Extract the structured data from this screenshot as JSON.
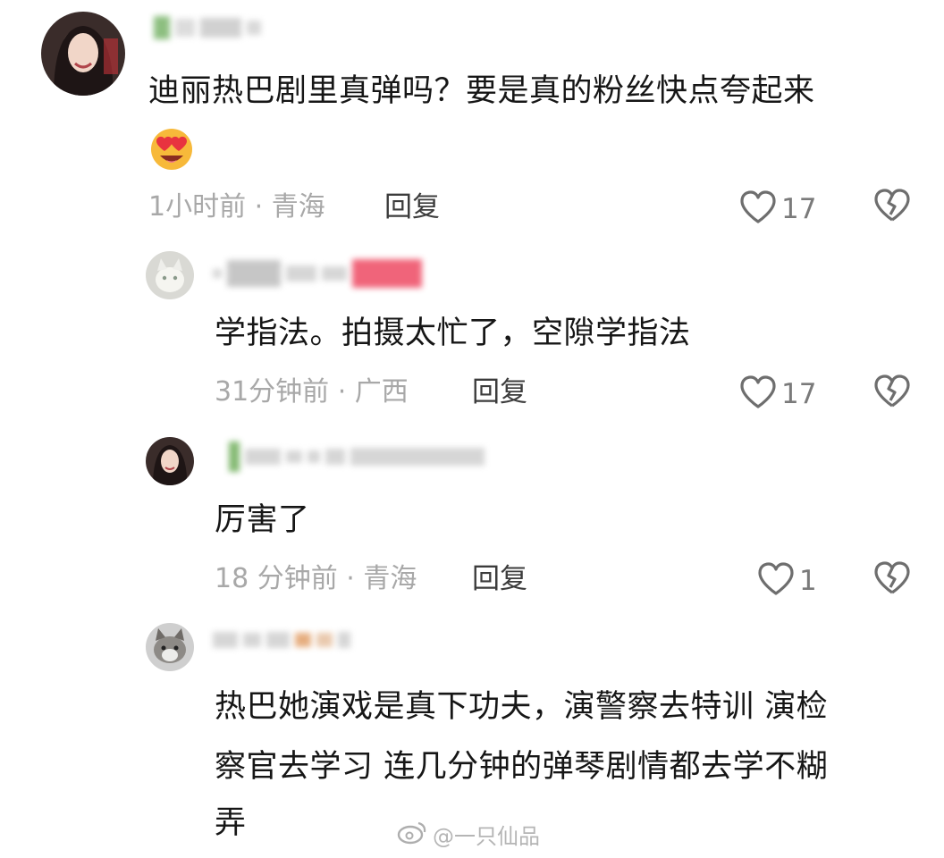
{
  "comments": [
    {
      "text": "迪丽热巴剧里真弹吗？要是真的粉丝快点夸起来",
      "time_location": "1小时前 · 青海",
      "reply_label": "回复",
      "likes": "17",
      "emoji_icon": "heart-eyes-emoji"
    },
    {
      "text": "学指法。拍摄太忙了，空隙学指法",
      "time_location": "31分钟前 · 广西",
      "reply_label": "回复",
      "likes": "17"
    },
    {
      "text": "厉害了",
      "time_location": "18 分钟前 · 青海",
      "reply_label": "回复",
      "likes": "1"
    },
    {
      "text_lines": [
        "热巴她演戏是真下功夫，演警察去特训 演检",
        "察官去学习 连几分钟的弹琴剧情都去学不糊",
        "弄"
      ]
    }
  ],
  "watermark": {
    "text": "@一只仙品",
    "icon": "weibo-icon"
  },
  "colors": {
    "text": "#161616",
    "meta": "#a8a8a8",
    "icon": "#6e6e6e",
    "background": "#ffffff"
  }
}
